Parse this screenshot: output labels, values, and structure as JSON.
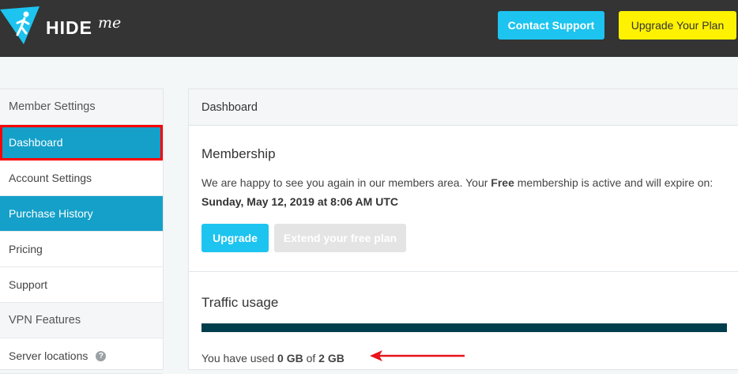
{
  "header": {
    "logo_text": "HIDE",
    "logo_suffix": "me",
    "contact_label": "Contact Support",
    "upgrade_plan_label": "Upgrade Your Plan"
  },
  "sidebar": {
    "items": [
      {
        "label": "Member Settings",
        "type": "heading"
      },
      {
        "label": "Dashboard",
        "type": "active"
      },
      {
        "label": "Account Settings",
        "type": "link"
      },
      {
        "label": "Purchase History",
        "type": "active"
      },
      {
        "label": "Pricing",
        "type": "link"
      },
      {
        "label": "Support",
        "type": "link"
      },
      {
        "label": "VPN Features",
        "type": "heading"
      },
      {
        "label": "Server locations",
        "type": "link",
        "help": "?"
      }
    ]
  },
  "panel": {
    "title": "Dashboard",
    "membership": {
      "title": "Membership",
      "text_before": "We are happy to see you again in our members area. Your ",
      "plan": "Free",
      "text_after": " membership is active and will expire on:",
      "expiry": "Sunday, May 12, 2019 at 8:06 AM UTC",
      "upgrade_label": "Upgrade",
      "extend_label": "Extend your free plan"
    },
    "traffic": {
      "title": "Traffic usage",
      "used_fraction": 0.0,
      "text_prefix": "You have used ",
      "used": "0 GB",
      "of": " of ",
      "total": "2 GB"
    }
  },
  "colors": {
    "brand_blue": "#1cc4ef",
    "active_blue": "#14a0c9",
    "upgrade_yellow": "#fff200",
    "header_dark": "#343434",
    "traffic_bar": "#003e4d",
    "highlight_red": "#ff0000"
  }
}
